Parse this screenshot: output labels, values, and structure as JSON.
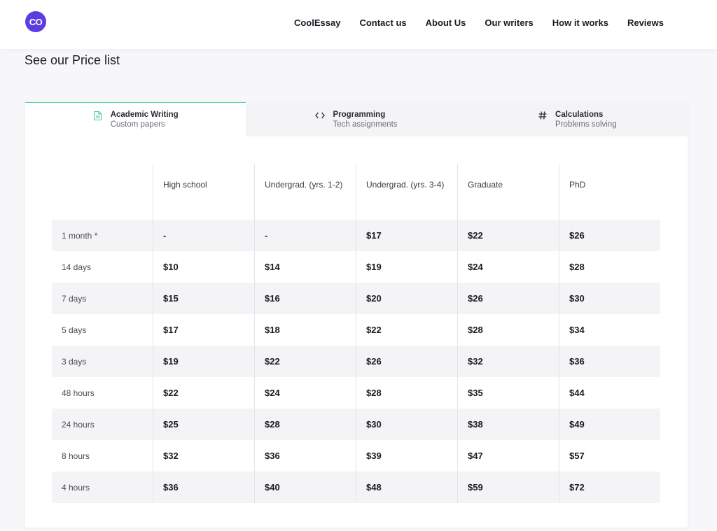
{
  "brand": {
    "logo_text": "CO",
    "logo_color": "#5b3de0"
  },
  "nav": [
    {
      "label": "CoolEssay"
    },
    {
      "label": "Contact us"
    },
    {
      "label": "About Us"
    },
    {
      "label": "Our writers"
    },
    {
      "label": "How it works"
    },
    {
      "label": "Reviews"
    }
  ],
  "page": {
    "title": "See our Price list"
  },
  "tabs": [
    {
      "label": "Academic Writing",
      "sub": "Custom papers",
      "icon": "document-icon",
      "active": true
    },
    {
      "label": "Programming",
      "sub": "Tech assignments",
      "icon": "code-icon",
      "active": false
    },
    {
      "label": "Calculations",
      "sub": "Problems solving",
      "icon": "hash-icon",
      "active": false
    }
  ],
  "table": {
    "columns": [
      "High school",
      "Undergrad. (yrs. 1-2)",
      "Undergrad. (yrs. 3-4)",
      "Graduate",
      "PhD"
    ],
    "rows": [
      {
        "label": "1 month *",
        "values": [
          "-",
          "-",
          "$17",
          "$22",
          "$26"
        ]
      },
      {
        "label": "14 days",
        "values": [
          "$10",
          "$14",
          "$19",
          "$24",
          "$28"
        ]
      },
      {
        "label": "7 days",
        "values": [
          "$15",
          "$16",
          "$20",
          "$26",
          "$30"
        ]
      },
      {
        "label": "5 days",
        "values": [
          "$17",
          "$18",
          "$22",
          "$28",
          "$34"
        ]
      },
      {
        "label": "3 days",
        "values": [
          "$19",
          "$22",
          "$26",
          "$32",
          "$36"
        ]
      },
      {
        "label": "48 hours",
        "values": [
          "$22",
          "$24",
          "$28",
          "$35",
          "$44"
        ]
      },
      {
        "label": "24 hours",
        "values": [
          "$25",
          "$28",
          "$30",
          "$38",
          "$49"
        ]
      },
      {
        "label": "8 hours",
        "values": [
          "$32",
          "$36",
          "$39",
          "$47",
          "$57"
        ]
      },
      {
        "label": "4 hours",
        "values": [
          "$36",
          "$40",
          "$48",
          "$59",
          "$72"
        ]
      }
    ]
  }
}
